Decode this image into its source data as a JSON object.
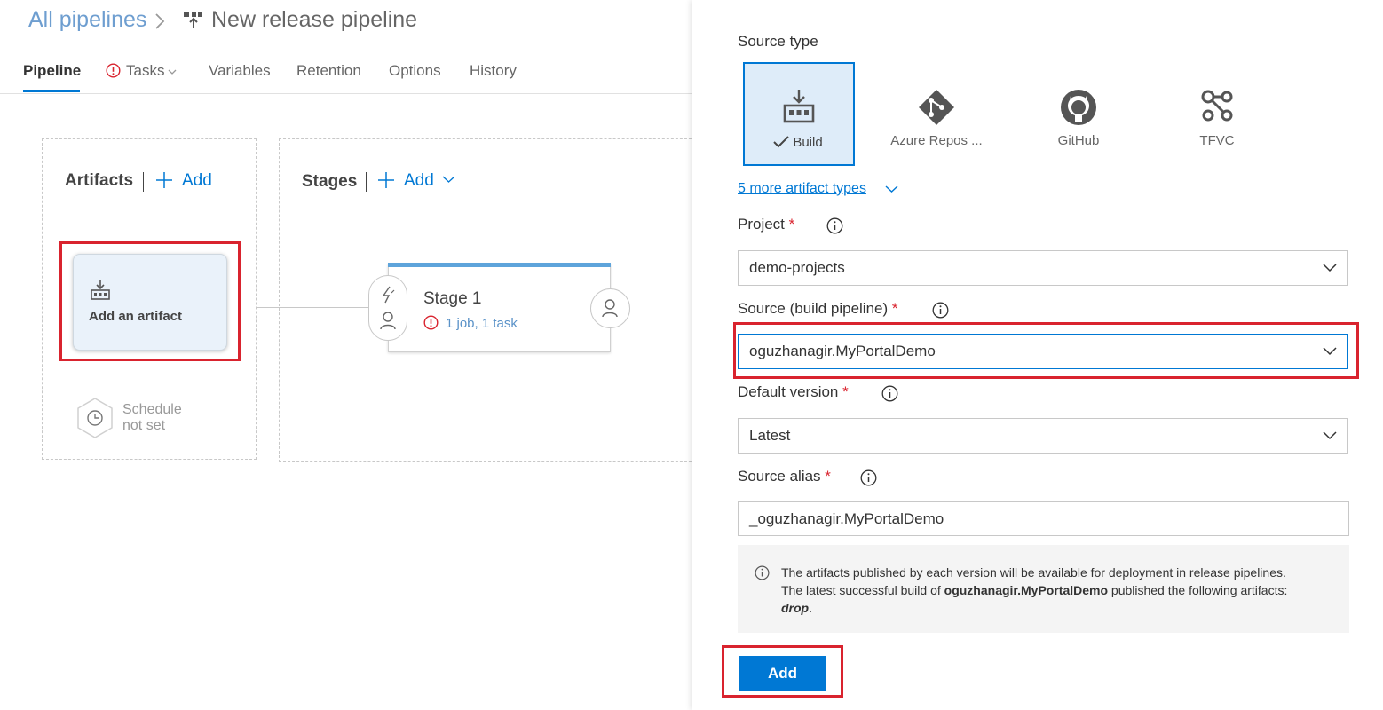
{
  "breadcrumb": {
    "root": "All pipelines",
    "title": "New release pipeline"
  },
  "tabs": [
    {
      "label": "Pipeline",
      "active": true
    },
    {
      "label": "Tasks",
      "warning": true
    },
    {
      "label": "Variables"
    },
    {
      "label": "Retention"
    },
    {
      "label": "Options"
    },
    {
      "label": "History"
    }
  ],
  "artifacts": {
    "title": "Artifacts",
    "add_label": "Add",
    "card_label": "Add an artifact",
    "schedule_line1": "Schedule",
    "schedule_line2": "not set"
  },
  "stages": {
    "title": "Stages",
    "add_label": "Add",
    "stage_name": "Stage 1",
    "stage_summary": "1 job, 1 task"
  },
  "panel": {
    "source_type_label": "Source type",
    "source_types": [
      {
        "label": "Build",
        "icon": "build-icon",
        "selected": true
      },
      {
        "label": "Azure Repos ...",
        "icon": "azure-repos-icon"
      },
      {
        "label": "GitHub",
        "icon": "github-icon"
      },
      {
        "label": "TFVC",
        "icon": "tfvc-icon"
      }
    ],
    "more_types": "5 more artifact types",
    "project_label": "Project",
    "project_value": "demo-projects",
    "source_label": "Source (build pipeline)",
    "source_value": "oguzhanagir.MyPortalDemo",
    "default_version_label": "Default version",
    "default_version_value": "Latest",
    "alias_label": "Source alias",
    "alias_value": "_oguzhanagir.MyPortalDemo",
    "required_mark": "*",
    "info_line1": "The artifacts published by each version will be available for deployment in release pipelines.",
    "info_line2_prefix": "The latest successful build of",
    "info_line2_bold": "oguzhanagir.MyPortalDemo",
    "info_line2_suffix": "published the following artifacts:",
    "info_artifact": "drop",
    "info_period": ".",
    "add_button": "Add"
  },
  "colors": {
    "accent": "#0078d4",
    "highlight_red": "#d9232e",
    "link_blue": "#6e9ed0",
    "stage_bar": "#5ea4db"
  }
}
